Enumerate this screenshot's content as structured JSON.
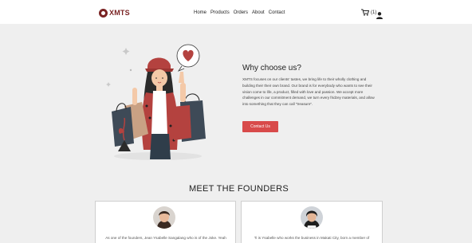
{
  "brand": {
    "name": "XMTS",
    "color": "#7a2323"
  },
  "nav": {
    "items": [
      "Home",
      "Products",
      "Orders",
      "About",
      "Contact"
    ],
    "cart_count": "(1)"
  },
  "why": {
    "title": "Why choose us?",
    "body": "XMTS focuses on our clients' tastes, we bring life to their wholly clothing and building their their own brand. Our brand is for everybody who wants to see their vision come to life, a product, filled with love and passion. We accept more challenges in our commitment demand, we turn every fridzey materials, and allow into something that they can call \"treasure\".",
    "button": "Contact Us",
    "accent": "#d84a4a"
  },
  "founders": {
    "title": "MEET THE FOUNDERS",
    "cards": [
      {
        "text": "As one of the founders, Jean Ysabelle Sangalang who is of the Joke. Yeah"
      },
      {
        "text": "Ti is Ysabelle who works the business in Makati City, born a member of"
      }
    ]
  }
}
